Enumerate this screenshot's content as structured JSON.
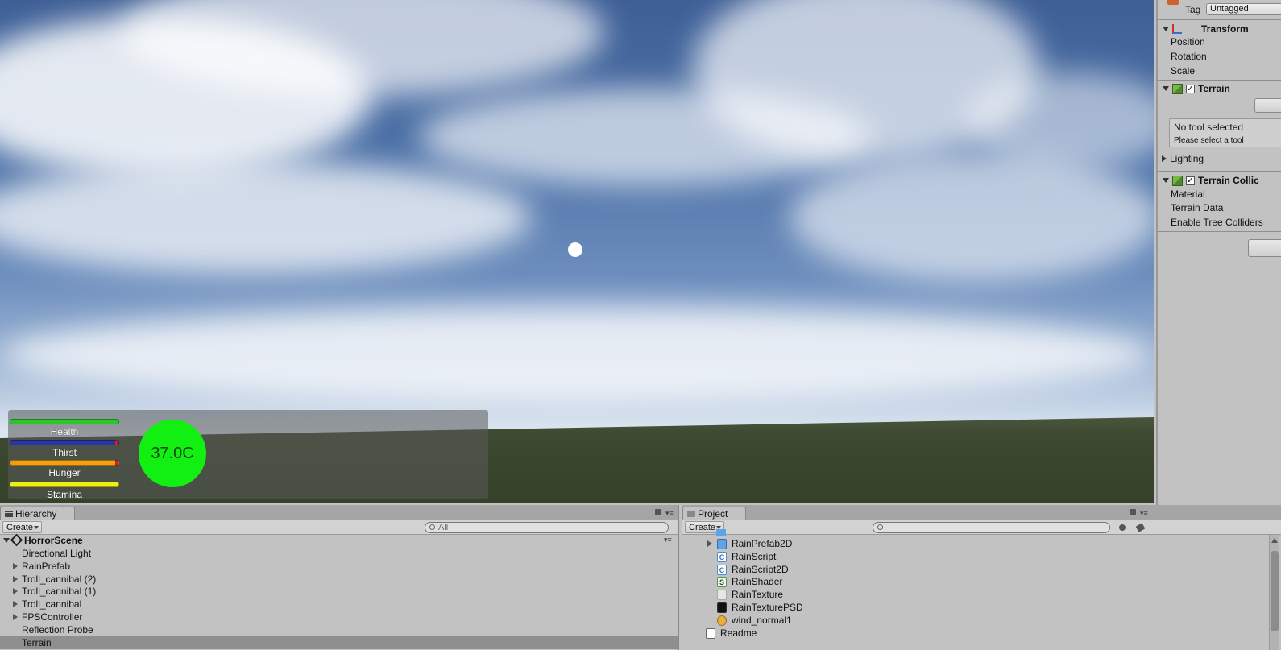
{
  "hud": {
    "bars": [
      {
        "label": "Health",
        "color": "#28c828",
        "fill": 1.0
      },
      {
        "label": "Thirst",
        "color": "#2b35a8",
        "fill": 1.0,
        "end_color": "#d02020"
      },
      {
        "label": "Hunger",
        "color": "#f0a010",
        "fill": 1.0,
        "end_color": "#d02020"
      },
      {
        "label": "Stamina",
        "color": "#f0f010",
        "fill": 1.0
      }
    ],
    "temperature": "37.0C",
    "temperature_color": "#12f012"
  },
  "inspector": {
    "tag_label": "Tag",
    "tag_value": "Untagged",
    "transform": {
      "title": "Transform",
      "fields": [
        "Position",
        "Rotation",
        "Scale"
      ]
    },
    "terrain": {
      "title": "Terrain",
      "tool_title": "No tool selected",
      "tool_hint": "Please select a tool",
      "lighting": "Lighting"
    },
    "terrain_collider": {
      "title": "Terrain Collic",
      "fields": [
        "Material",
        "Terrain Data",
        "Enable Tree Colliders"
      ]
    }
  },
  "hierarchy": {
    "tab": "Hierarchy",
    "create": "Create",
    "search_placeholder": "All",
    "scene": "HorrorScene",
    "items": [
      {
        "label": "Directional Light",
        "expandable": false
      },
      {
        "label": "RainPrefab",
        "expandable": true
      },
      {
        "label": "Troll_cannibal (2)",
        "expandable": true
      },
      {
        "label": "Troll_cannibal (1)",
        "expandable": true
      },
      {
        "label": "Troll_cannibal",
        "expandable": true
      },
      {
        "label": "FPSController",
        "expandable": true
      },
      {
        "label": "Reflection Probe",
        "expandable": false
      },
      {
        "label": "Terrain",
        "expandable": false,
        "selected": true
      }
    ]
  },
  "project": {
    "tab": "Project",
    "create": "Create",
    "search_placeholder": "",
    "items": [
      {
        "label": "RainPrefab2D",
        "icon": "prefab-icon",
        "expandable": true
      },
      {
        "label": "RainScript",
        "icon": "csharp-script-icon"
      },
      {
        "label": "RainScript2D",
        "icon": "csharp-script-icon"
      },
      {
        "label": "RainShader",
        "icon": "shader-icon"
      },
      {
        "label": "RainTexture",
        "icon": "texture-icon"
      },
      {
        "label": "RainTexturePSD",
        "icon": "psd-texture-icon"
      },
      {
        "label": "wind_normal1",
        "icon": "wind-texture-icon"
      },
      {
        "label": "Readme",
        "icon": "document-icon"
      }
    ]
  }
}
